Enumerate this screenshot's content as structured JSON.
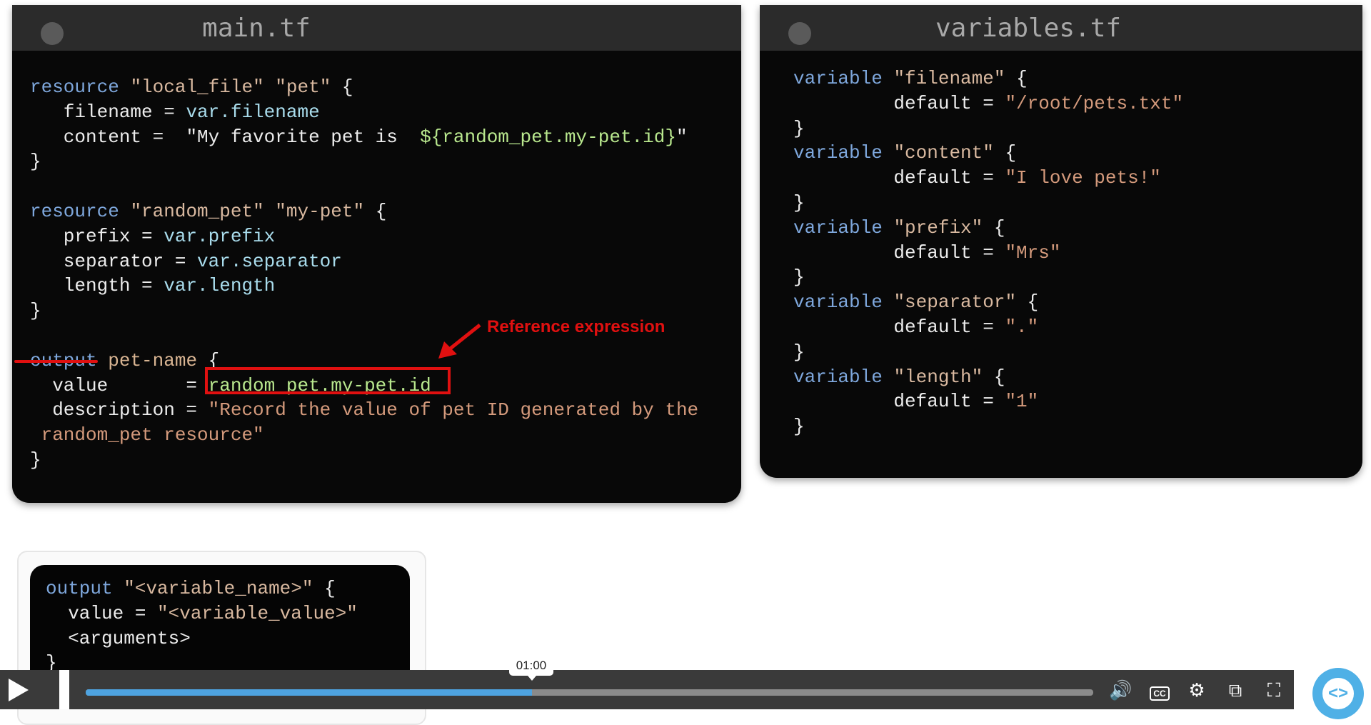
{
  "main_panel": {
    "title": "main.tf",
    "lines": [
      [
        [
          "kw",
          "resource"
        ],
        [
          "pl",
          " "
        ],
        [
          "str",
          "\"local_file\""
        ],
        [
          "pl",
          " "
        ],
        [
          "str",
          "\"pet\""
        ],
        [
          "pl",
          " {"
        ]
      ],
      [
        [
          "pl",
          "   filename = "
        ],
        [
          "var",
          "var.filename"
        ]
      ],
      [
        [
          "pl",
          "   content =  "
        ],
        [
          "pl",
          "\"My favorite pet is  "
        ],
        [
          "grn",
          "${random_pet.my-pet.id}"
        ],
        [
          "pl",
          "\""
        ]
      ],
      [
        [
          "pl",
          "}"
        ]
      ],
      [],
      [
        [
          "kw",
          "resource"
        ],
        [
          "pl",
          " "
        ],
        [
          "str",
          "\"random_pet\""
        ],
        [
          "pl",
          " "
        ],
        [
          "str",
          "\"my-pet\""
        ],
        [
          "pl",
          " {"
        ]
      ],
      [
        [
          "pl",
          "   prefix = "
        ],
        [
          "var",
          "var.prefix"
        ]
      ],
      [
        [
          "pl",
          "   separator = "
        ],
        [
          "var",
          "var.separator"
        ]
      ],
      [
        [
          "pl",
          "   length = "
        ],
        [
          "var",
          "var.length"
        ]
      ],
      [
        [
          "pl",
          "}"
        ]
      ],
      [],
      [
        [
          "kw",
          "output"
        ],
        [
          "pl",
          " "
        ],
        [
          "nm",
          "pet-name"
        ],
        [
          "pl",
          " {"
        ]
      ],
      [
        [
          "pl",
          "  value       = "
        ],
        [
          "grn",
          "random_pet.my-pet.id"
        ]
      ],
      [
        [
          "pl",
          "  description = "
        ],
        [
          "dstr",
          "\"Record the value of pet ID generated by the"
        ]
      ],
      [
        [
          "dstr",
          " random_pet resource\""
        ]
      ],
      [
        [
          "pl",
          "}"
        ]
      ]
    ]
  },
  "annotation": {
    "label": "Reference expression",
    "color": "#e01010"
  },
  "variables_panel": {
    "title": "variables.tf",
    "lines": [
      [
        [
          "kw",
          "variable"
        ],
        [
          "pl",
          " "
        ],
        [
          "str",
          "\"filename\""
        ],
        [
          "pl",
          " {"
        ]
      ],
      [
        [
          "pl",
          "         default = "
        ],
        [
          "dstr",
          "\"/root/pets.txt\""
        ]
      ],
      [
        [
          "pl",
          "}"
        ]
      ],
      [
        [
          "kw",
          "variable"
        ],
        [
          "pl",
          " "
        ],
        [
          "str",
          "\"content\""
        ],
        [
          "pl",
          " {"
        ]
      ],
      [
        [
          "pl",
          "         default = "
        ],
        [
          "dstr",
          "\"I love pets!\""
        ]
      ],
      [
        [
          "pl",
          "}"
        ]
      ],
      [
        [
          "kw",
          "variable"
        ],
        [
          "pl",
          " "
        ],
        [
          "str",
          "\"prefix\""
        ],
        [
          "pl",
          " {"
        ]
      ],
      [
        [
          "pl",
          "         default = "
        ],
        [
          "dstr",
          "\"Mrs\""
        ]
      ],
      [
        [
          "pl",
          "}"
        ]
      ],
      [
        [
          "kw",
          "variable"
        ],
        [
          "pl",
          " "
        ],
        [
          "str",
          "\"separator\""
        ],
        [
          "pl",
          " {"
        ]
      ],
      [
        [
          "pl",
          "         default = "
        ],
        [
          "dstr",
          "\".\""
        ]
      ],
      [
        [
          "pl",
          "}"
        ]
      ],
      [
        [
          "kw",
          "variable"
        ],
        [
          "pl",
          " "
        ],
        [
          "str",
          "\"length\""
        ],
        [
          "pl",
          " {"
        ]
      ],
      [
        [
          "pl",
          "         default = "
        ],
        [
          "dstr",
          "\"1\""
        ]
      ],
      [
        [
          "pl",
          "}"
        ]
      ]
    ]
  },
  "template_box": {
    "lines": [
      [
        [
          "kw",
          "output"
        ],
        [
          "pl",
          " "
        ],
        [
          "str",
          "\"<variable_name>\""
        ],
        [
          "pl",
          " {"
        ]
      ],
      [
        [
          "pl",
          "  value = "
        ],
        [
          "str",
          "\"<variable_value>\""
        ]
      ],
      [
        [
          "pl",
          "  <arguments>"
        ]
      ],
      [
        [
          "pl",
          "}"
        ]
      ]
    ]
  },
  "player": {
    "time_tooltip": "01:00",
    "progress_percent": 44.3,
    "progress_color": "#4ea3e0",
    "icons": [
      "play-icon",
      "volume-icon",
      "captions-icon",
      "settings-icon",
      "picture-in-picture-icon",
      "fullscreen-icon"
    ],
    "cc_label": "CC"
  }
}
